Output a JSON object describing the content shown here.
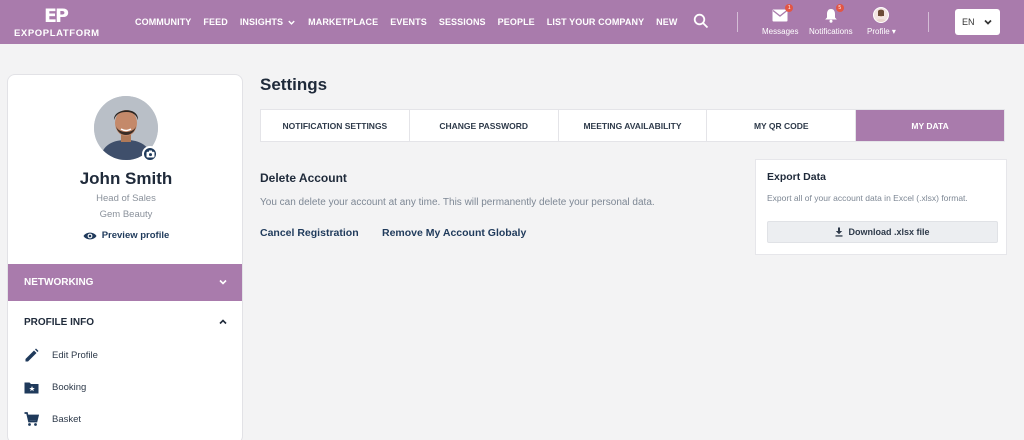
{
  "brand": {
    "mark": "EP",
    "name": "EXPOPLATFORM"
  },
  "nav": [
    {
      "label": "COMMUNITY"
    },
    {
      "label": "FEED"
    },
    {
      "label": "INSIGHTS"
    },
    {
      "label": "MARKETPLACE"
    },
    {
      "label": "EVENTS"
    },
    {
      "label": "SESSIONS"
    },
    {
      "label": "PEOPLE"
    },
    {
      "label": "LIST YOUR COMPANY"
    },
    {
      "label": "NEW"
    }
  ],
  "header": {
    "messages": {
      "label": "Messages",
      "count": "1"
    },
    "notifications": {
      "label": "Notifications",
      "count": "5"
    },
    "profile": {
      "label": "Profile"
    },
    "language": "EN"
  },
  "profile": {
    "name": "John Smith",
    "role": "Head of Sales",
    "company": "Gem Beauty",
    "preview_label": "Preview profile"
  },
  "sidebar": {
    "networking_label": "NETWORKING",
    "profile_info_label": "PROFILE INFO",
    "items": [
      {
        "label": "Edit Profile",
        "icon": "pencil-icon"
      },
      {
        "label": "Booking",
        "icon": "folder-star-icon"
      },
      {
        "label": "Basket",
        "icon": "cart-icon"
      }
    ]
  },
  "main": {
    "title": "Settings",
    "tabs": [
      {
        "label": "NOTIFICATION SETTINGS",
        "active": false
      },
      {
        "label": "CHANGE PASSWORD",
        "active": false
      },
      {
        "label": "MEETING AVAILABILITY",
        "active": false
      },
      {
        "label": "MY QR CODE",
        "active": false
      },
      {
        "label": "MY DATA",
        "active": true
      }
    ],
    "delete_account": {
      "title": "Delete Account",
      "description": "You can delete your account at any time. This will permanently delete your personal data.",
      "cancel_label": "Cancel Registration",
      "remove_label": "Remove My Account Globaly"
    },
    "export": {
      "title": "Export Data",
      "description": "Export all of your account data in Excel (.xlsx) format.",
      "button_label": "Download .xlsx file"
    }
  },
  "colors": {
    "accent": "#a97bac",
    "navy": "#1f3a5b",
    "badge": "#e25545"
  }
}
